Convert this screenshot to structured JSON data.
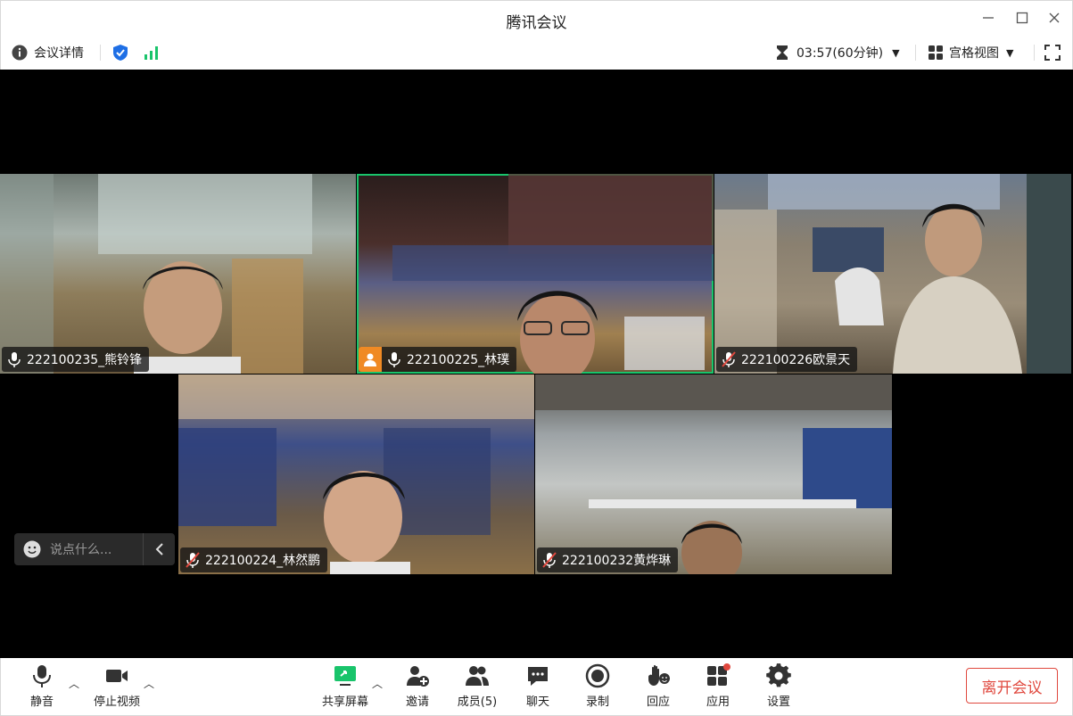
{
  "window": {
    "title": "腾讯会议"
  },
  "infobar": {
    "details_label": "会议详情",
    "timer": "03:57(60分钟)",
    "view_label": "宫格视图"
  },
  "participants": [
    {
      "name": "222100235_熊铃锋",
      "muted": false,
      "host": false
    },
    {
      "name": "222100225_林璞",
      "muted": false,
      "host": true,
      "speaking": true
    },
    {
      "name": "222100226欧景天",
      "muted": true,
      "host": false
    },
    {
      "name": "222100224_林然鹏",
      "muted": true,
      "host": false
    },
    {
      "name": "222100232黄烨琳",
      "muted": true,
      "host": false
    }
  ],
  "chat": {
    "placeholder": "说点什么..."
  },
  "toolbar": {
    "mute": "静音",
    "stop_video": "停止视频",
    "share": "共享屏幕",
    "invite": "邀请",
    "members": "成员(5)",
    "chat": "聊天",
    "record": "录制",
    "react": "回应",
    "apps": "应用",
    "settings": "设置",
    "leave": "离开会议"
  },
  "colors": {
    "accent_green": "#19c46b",
    "leave_red": "#e0483e",
    "host_orange": "#f08a24",
    "shield_blue": "#1f6fe5"
  }
}
